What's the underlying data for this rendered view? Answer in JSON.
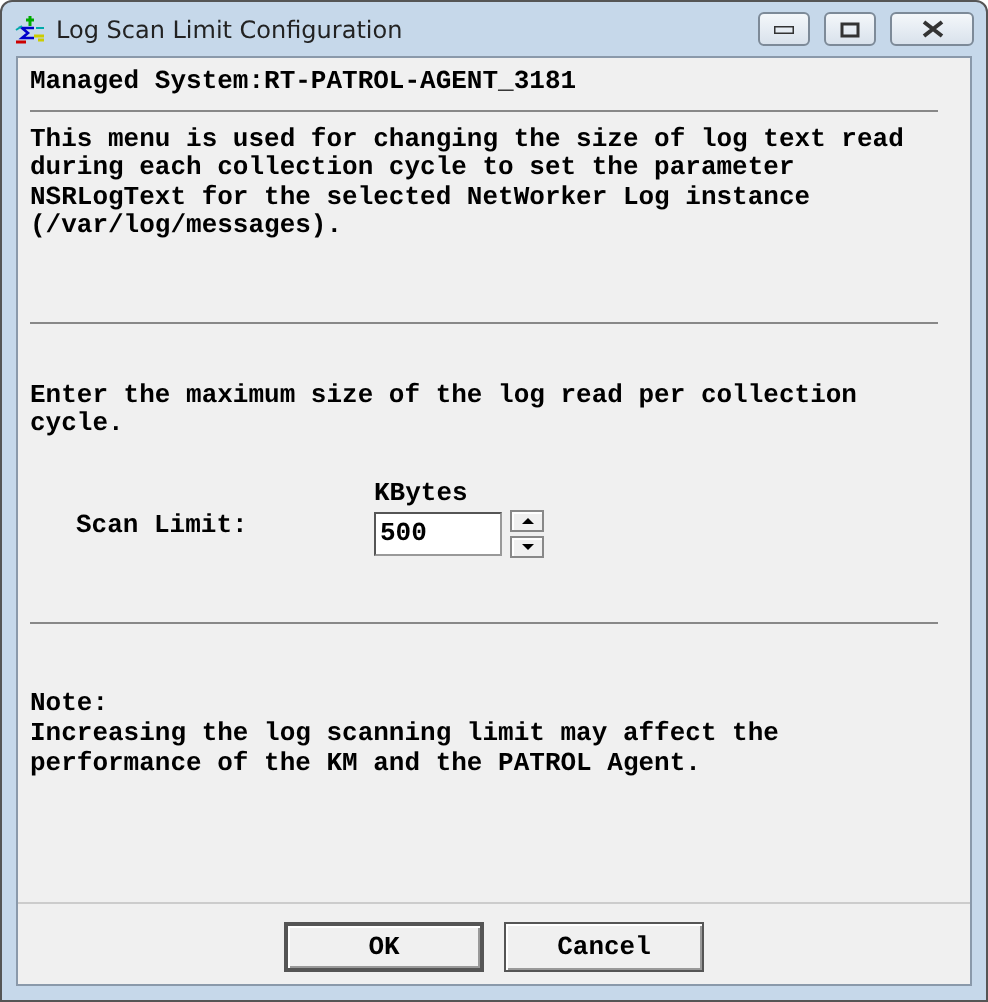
{
  "window": {
    "title": "Log Scan Limit Configuration"
  },
  "managed_system": "Managed System:RT-PATROL-AGENT_3181",
  "description": "This menu is used for changing the size of log text read during each collection cycle to set the parameter NSRLogText for the selected NetWorker Log instance (/var/log/messages).",
  "instruction": "Enter the maximum size of the log read per collection cycle.",
  "scan_limit": {
    "label": "Scan Limit:",
    "unit": "KBytes",
    "value": "500"
  },
  "note": {
    "heading": "Note:",
    "text": "Increasing the log scanning limit may affect the performance of the KM and the PATROL Agent."
  },
  "buttons": [
    {
      "label": "OK",
      "default": true
    },
    {
      "label": "Cancel",
      "default": false
    }
  ]
}
